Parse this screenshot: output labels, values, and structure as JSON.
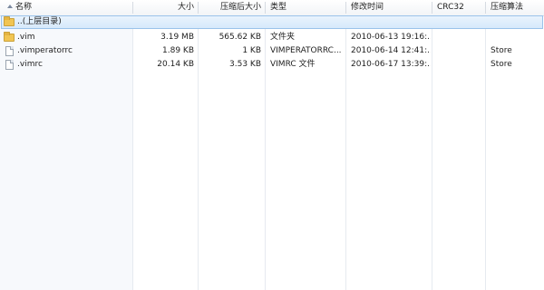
{
  "columns": {
    "name": "名称",
    "size": "大小",
    "packed_size": "压缩后大小",
    "type": "类型",
    "modified": "修改时间",
    "crc": "CRC32",
    "method": "压缩算法"
  },
  "parent_row": {
    "label": "..(上层目录)"
  },
  "files": [
    {
      "name": ".vim",
      "size": "3.19 MB",
      "packed": "565.62 KB",
      "type": "文件夹",
      "modified": "2010-06-13 19:16:...",
      "crc": "",
      "method": "",
      "icon": "folder-icon"
    },
    {
      "name": ".vimperatorrc",
      "size": "1.89 KB",
      "packed": "1 KB",
      "type": "VIMPERATORRC...",
      "modified": "2010-06-14 12:41:...",
      "crc": "",
      "method": "Store",
      "icon": "file-icon"
    },
    {
      "name": ".vimrc",
      "size": "20.14 KB",
      "packed": "3.53 KB",
      "type": "VIMRC 文件",
      "modified": "2010-06-17 13:39:...",
      "crc": "",
      "method": "Store",
      "icon": "file-icon"
    }
  ]
}
